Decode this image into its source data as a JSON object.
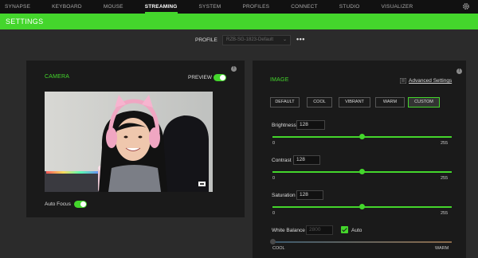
{
  "nav": {
    "tabs": [
      {
        "label": "SYNAPSE",
        "active": false
      },
      {
        "label": "KEYBOARD",
        "active": false
      },
      {
        "label": "MOUSE",
        "active": false
      },
      {
        "label": "STREAMING",
        "active": true
      },
      {
        "label": "SYSTEM",
        "active": false
      },
      {
        "label": "PROFILES",
        "active": false
      },
      {
        "label": "CONNECT",
        "active": false
      },
      {
        "label": "STUDIO",
        "active": false
      },
      {
        "label": "VISUALIZER",
        "active": false
      }
    ],
    "settings_icon": "gear-icon"
  },
  "header": {
    "title": "SETTINGS"
  },
  "profile": {
    "label": "PROFILE",
    "value": "RZB-SG-1823-Default",
    "more": "•••"
  },
  "camera": {
    "title": "CAMERA",
    "preview_label": "PREVIEW",
    "preview_on": true,
    "autofocus_label": "Auto Focus",
    "autofocus_on": true
  },
  "image": {
    "title": "IMAGE",
    "advanced_link": "Advanced Settings",
    "presets": [
      {
        "label": "DEFAULT",
        "active": false
      },
      {
        "label": "COOL",
        "active": false
      },
      {
        "label": "VIBRANT",
        "active": false
      },
      {
        "label": "WARM",
        "active": false
      },
      {
        "label": "CUSTOM",
        "active": true
      }
    ],
    "brightness": {
      "label": "Brightness",
      "value": "128",
      "min": "0",
      "max": "255",
      "level": 128
    },
    "contrast": {
      "label": "Contrast",
      "value": "128",
      "min": "0",
      "max": "255",
      "level": 128
    },
    "saturation": {
      "label": "Saturation",
      "value": "128",
      "min": "0",
      "max": "255",
      "level": 128
    },
    "white_balance": {
      "label": "White Balance",
      "value": "2800",
      "auto_label": "Auto",
      "auto_checked": true,
      "min_label": "COOL",
      "max_label": "WARM",
      "level": 0
    }
  },
  "colors": {
    "accent": "#44d62c",
    "panel": "#1a1a1a",
    "background": "#2b2b2b"
  }
}
